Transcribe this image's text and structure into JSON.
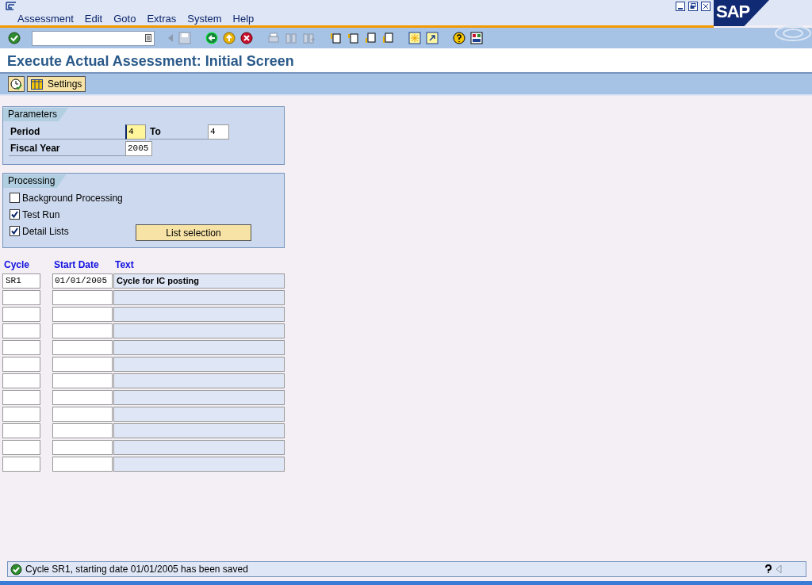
{
  "menu": [
    "Assessment",
    "Edit",
    "Goto",
    "Extras",
    "System",
    "Help"
  ],
  "logo": "SAP",
  "title": "Execute Actual Assessment: Initial Screen",
  "app_toolbar": {
    "settings_label": "Settings"
  },
  "parameters": {
    "title": "Parameters",
    "fields": [
      {
        "label": "Period",
        "value": "4",
        "focused": true,
        "to_label": "To",
        "to_value": "4"
      },
      {
        "label": "Fiscal Year",
        "value": "2005",
        "focused": false
      }
    ]
  },
  "processing": {
    "title": "Processing",
    "options": [
      {
        "label": "Background Processing",
        "checked": false
      },
      {
        "label": "Test Run",
        "checked": true
      },
      {
        "label": "Detail Lists",
        "checked": true
      }
    ],
    "button": "List selection"
  },
  "table": {
    "columns": [
      "Cycle",
      "Start Date",
      "Text"
    ],
    "rows": [
      {
        "cycle": "SR1",
        "start_date": "01/01/2005",
        "text": "Cycle for IC posting"
      },
      {},
      {},
      {},
      {},
      {},
      {},
      {},
      {},
      {},
      {},
      {}
    ]
  },
  "status_bar": {
    "message": "Cycle SR1, starting date 01/01/2005 has been saved"
  }
}
